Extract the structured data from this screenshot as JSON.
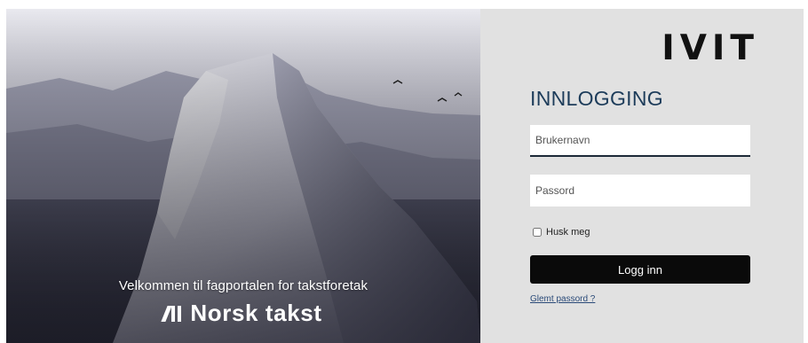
{
  "hero": {
    "welcome_text": "Velkommen til fagportalen for takstforetak",
    "brand_name": "Norsk takst"
  },
  "login": {
    "logo_text": "IVIT",
    "title": "INNLOGGING",
    "username_placeholder": "Brukernavn",
    "password_placeholder": "Passord",
    "remember_label": "Husk meg",
    "submit_label": "Logg inn",
    "forgot_link": "Glemt passord ?"
  },
  "colors": {
    "panel_bg": "#e1e1e1",
    "title": "#1d3c5a",
    "button_bg": "#0a0a0a",
    "link": "#2a4a78"
  }
}
